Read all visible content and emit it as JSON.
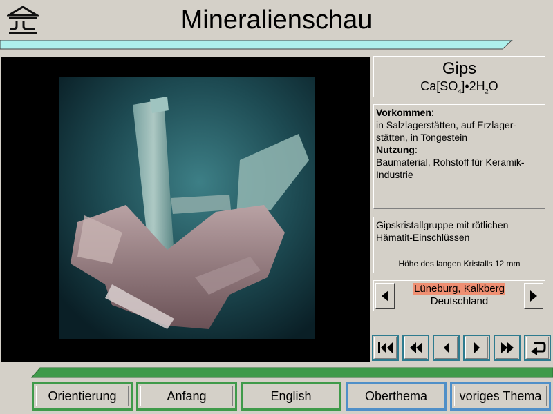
{
  "header": {
    "title": "Mineralienschau",
    "logo_icon": "museum-temple-icon"
  },
  "mineral": {
    "name": "Gips",
    "formula_parts": [
      "Ca[SO",
      "4",
      "]•2H",
      "2",
      "O"
    ]
  },
  "info": {
    "occurrence_label": "Vorkommen",
    "occurrence_text": "in Salzlagerstätten, auf Erzlager-stätten, in Tongestein",
    "occurrence_line1": "in Salzlagerstätten, auf Erzlager-",
    "occurrence_line2": "stätten, in Tongestein",
    "usage_label": "Nutzung",
    "usage_line1": "Baumaterial, Rohstoff für Keramik-",
    "usage_line2": "Industrie"
  },
  "description": {
    "line1": "Gipskristallgruppe mit rötlichen",
    "line2": "Hämatit-Einschlüssen",
    "size_note": "Höhe des langen Kristalls 12 mm"
  },
  "location": {
    "place": "Lüneburg, Kalkberg",
    "country": "Deutschland",
    "highlight_color": "#ef8f72"
  },
  "nav_icons": [
    "first-icon",
    "rewind-icon",
    "previous-icon",
    "next-icon",
    "fast-forward-icon",
    "return-icon"
  ],
  "buttons": {
    "orientation": "Orientierung",
    "start": "Anfang",
    "english": "English",
    "parent_topic": "Oberthema",
    "previous_topic": "voriges Thema"
  },
  "colors": {
    "band": "#aef0ec",
    "bottom_band": "#3f9a4a",
    "green_frame": "#3f9a4a",
    "blue_frame": "#4f8fc8",
    "nav_frame": "#2e7b8f"
  }
}
